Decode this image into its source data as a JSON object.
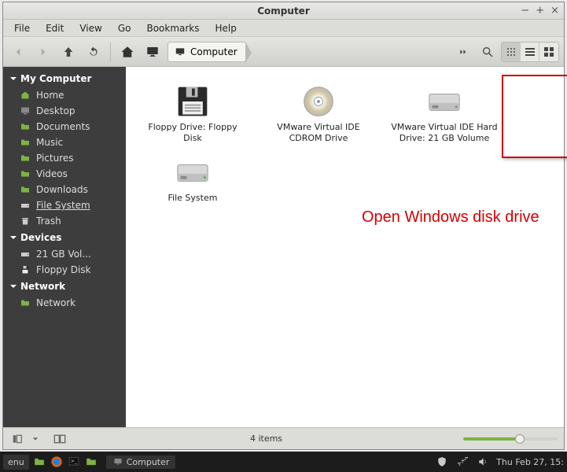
{
  "window": {
    "title": "Computer"
  },
  "menubar": {
    "items": [
      "File",
      "Edit",
      "View",
      "Go",
      "Bookmarks",
      "Help"
    ]
  },
  "toolbar": {
    "location_label": "Computer"
  },
  "sidebar": {
    "sections": [
      {
        "label": "My Computer",
        "items": [
          {
            "icon": "home",
            "label": "Home"
          },
          {
            "icon": "desktop",
            "label": "Desktop"
          },
          {
            "icon": "folder",
            "label": "Documents"
          },
          {
            "icon": "music",
            "label": "Music"
          },
          {
            "icon": "pictures",
            "label": "Pictures"
          },
          {
            "icon": "videos",
            "label": "Videos"
          },
          {
            "icon": "downloads",
            "label": "Downloads"
          },
          {
            "icon": "drive",
            "label": "File System",
            "selected": true
          },
          {
            "icon": "trash",
            "label": "Trash"
          }
        ]
      },
      {
        "label": "Devices",
        "items": [
          {
            "icon": "drive",
            "label": "21 GB Vol..."
          },
          {
            "icon": "floppy",
            "label": "Floppy Disk"
          }
        ]
      },
      {
        "label": "Network",
        "items": [
          {
            "icon": "network",
            "label": "Network"
          }
        ]
      }
    ]
  },
  "main": {
    "items": [
      {
        "icon": "floppy",
        "label": "Floppy Drive: Floppy Disk"
      },
      {
        "icon": "cdrom",
        "label": "VMware Virtual IDE CDROM Drive"
      },
      {
        "icon": "hdd",
        "label": "VMware Virtual IDE Hard Drive: 21 GB Volume",
        "highlighted": true
      },
      {
        "icon": "hdd",
        "label": "File System"
      }
    ]
  },
  "annotation": "Open Windows disk drive",
  "statusbar": {
    "text": "4 items"
  },
  "taskbar": {
    "menu_fragment": "enu",
    "app_label": "Computer",
    "clock": "Thu Feb 27, 15:"
  }
}
